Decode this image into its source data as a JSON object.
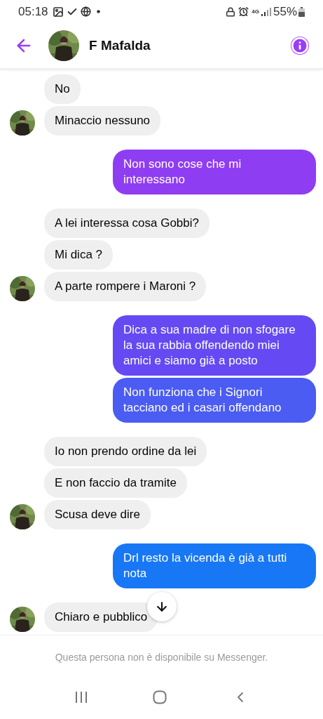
{
  "status_bar": {
    "time": "05:18",
    "network": "4G",
    "battery": "55%"
  },
  "header": {
    "contact_name": "F Mafalda"
  },
  "messages": [
    {
      "kind": "received",
      "bubbles": [
        {
          "text": "No"
        },
        {
          "text": "Minaccio nessuno"
        }
      ]
    },
    {
      "kind": "sent",
      "bubbles": [
        {
          "text": "Non sono cose che mi interessano",
          "color": "#8f3df2"
        }
      ]
    },
    {
      "kind": "received",
      "bubbles": [
        {
          "text": "A lei interessa cosa Gobbi?"
        },
        {
          "text": "Mi dica ?"
        },
        {
          "text": "A parte rompere i Maroni ?"
        }
      ]
    },
    {
      "kind": "sent",
      "bubbles": [
        {
          "text": "Dica a sua madre di non sfogare la sua rabbia offendendo miei amici e siamo già a posto",
          "color": "#6549f2"
        },
        {
          "text": "Non funziona che i Signori tacciano ed i casari offendano",
          "color": "#4a5cf2"
        }
      ]
    },
    {
      "kind": "received",
      "bubbles": [
        {
          "text": "Io non prendo ordine da lei"
        },
        {
          "text": "E non faccio da tramite"
        },
        {
          "text": "Scusa deve dire"
        }
      ]
    },
    {
      "kind": "sent",
      "bubbles": [
        {
          "text": "Drl resto la vicenda è già a tutti nota",
          "color": "#1877f5"
        }
      ]
    },
    {
      "kind": "received",
      "bubbles": [
        {
          "text": "Chiaro e pubblico"
        }
      ]
    }
  ],
  "footer": {
    "notice": "Questa persona non è disponibile su Messenger."
  }
}
